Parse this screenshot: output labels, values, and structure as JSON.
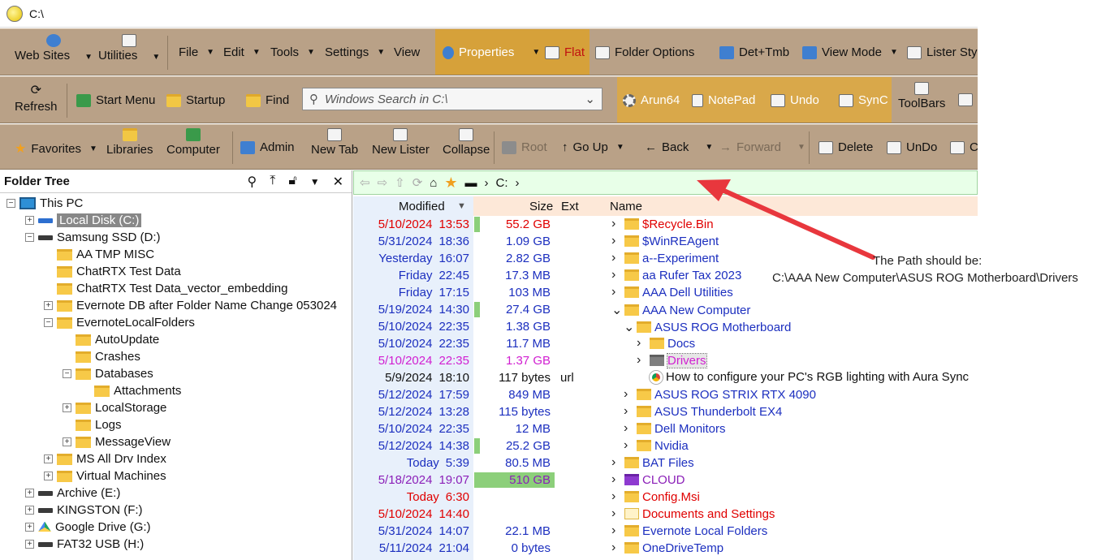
{
  "window": {
    "title": "C:\\"
  },
  "toolbar1": {
    "web_sites": "Web Sites",
    "utilities": "Utilities",
    "file": "File",
    "edit": "Edit",
    "tools": "Tools",
    "settings": "Settings",
    "view": "View",
    "properties": "Properties",
    "flat": "Flat",
    "folder_options": "Folder Options",
    "det_tmb": "Det+Tmb",
    "view_mode": "View Mode",
    "lister_style": "Lister Styl"
  },
  "toolbar2": {
    "refresh": "Refresh",
    "start_menu": "Start Menu",
    "startup": "Startup",
    "find": "Find",
    "search_placeholder": "Windows Search in C:\\",
    "arun64": "Arun64",
    "notepad": "NotePad",
    "undo": "Undo",
    "sync": "SynC",
    "toolbars": "ToolBars"
  },
  "toolbar3": {
    "favorites": "Favorites",
    "libraries": "Libraries",
    "computer": "Computer",
    "admin": "Admin",
    "new_tab": "New Tab",
    "new_lister": "New Lister",
    "collapse": "Collapse",
    "root": "Root",
    "go_up": "Go Up",
    "back": "Back",
    "forward": "Forward",
    "delete": "Delete",
    "undo": "UnDo",
    "co": "Co"
  },
  "folder_tree": {
    "title": "Folder Tree",
    "items": [
      {
        "label": "This PC",
        "icon": "pc-icon",
        "indent": 0,
        "exp": "−"
      },
      {
        "label": "Local Disk (C:)",
        "icon": "windows-drive-icon",
        "indent": 1,
        "exp": "+",
        "selected": true
      },
      {
        "label": "Samsung SSD (D:)",
        "icon": "drive-icon",
        "indent": 1,
        "exp": "−"
      },
      {
        "label": "AA TMP MISC",
        "icon": "folder-icon",
        "indent": 2,
        "exp": ""
      },
      {
        "label": "ChatRTX Test Data",
        "icon": "folder-icon",
        "indent": 2,
        "exp": ""
      },
      {
        "label": "ChatRTX Test Data_vector_embedding",
        "icon": "folder-icon",
        "indent": 2,
        "exp": ""
      },
      {
        "label": "Evernote DB after Folder Name Change 053024",
        "icon": "folder-icon",
        "indent": 2,
        "exp": "+"
      },
      {
        "label": "EvernoteLocalFolders",
        "icon": "folder-icon",
        "indent": 2,
        "exp": "−"
      },
      {
        "label": "AutoUpdate",
        "icon": "folder-icon",
        "indent": 3,
        "exp": ""
      },
      {
        "label": "Crashes",
        "icon": "folder-icon",
        "indent": 3,
        "exp": ""
      },
      {
        "label": "Databases",
        "icon": "folder-icon",
        "indent": 3,
        "exp": "−"
      },
      {
        "label": "Attachments",
        "icon": "folder-icon",
        "indent": 4,
        "exp": ""
      },
      {
        "label": "LocalStorage",
        "icon": "folder-icon",
        "indent": 3,
        "exp": "+"
      },
      {
        "label": "Logs",
        "icon": "folder-icon",
        "indent": 3,
        "exp": ""
      },
      {
        "label": "MessageView",
        "icon": "folder-icon",
        "indent": 3,
        "exp": "+"
      },
      {
        "label": "MS All Drv Index",
        "icon": "folder-icon",
        "indent": 2,
        "exp": "+"
      },
      {
        "label": "Virtual Machines",
        "icon": "folder-icon",
        "indent": 2,
        "exp": "+"
      },
      {
        "label": "Archive (E:)",
        "icon": "drive-icon",
        "indent": 1,
        "exp": "+"
      },
      {
        "label": "KINGSTON (F:)",
        "icon": "drive-icon",
        "indent": 1,
        "exp": "+"
      },
      {
        "label": "Google Drive (G:)",
        "icon": "google-drive-icon",
        "indent": 1,
        "exp": "+"
      },
      {
        "label": "FAT32 USB (H:)",
        "icon": "drive-icon",
        "indent": 1,
        "exp": "+"
      }
    ]
  },
  "lister": {
    "path": "C:",
    "columns": {
      "modified": "Modified",
      "size": "Size",
      "ext": "Ext",
      "name": "Name"
    },
    "rows": [
      {
        "date": "5/10/2024",
        "time": "13:53",
        "size": "55.2 GB",
        "ext": "",
        "name": "$Recycle.Bin",
        "color": "red",
        "depth": 0,
        "arrow": ">",
        "bar": "small",
        "icon": "folder"
      },
      {
        "date": "5/31/2024",
        "time": "18:36",
        "size": "1.09 GB",
        "ext": "",
        "name": "$WinREAgent",
        "color": "blue",
        "depth": 0,
        "arrow": ">",
        "bar": "",
        "icon": "folder"
      },
      {
        "date": "Yesterday",
        "time": "16:07",
        "size": "2.82 GB",
        "ext": "",
        "name": "a--Experiment",
        "color": "blue",
        "depth": 0,
        "arrow": ">",
        "bar": "",
        "icon": "folder"
      },
      {
        "date": "Friday",
        "time": "22:45",
        "size": "17.3 MB",
        "ext": "",
        "name": "aa Rufer Tax 2023",
        "color": "blue",
        "depth": 0,
        "arrow": ">",
        "bar": "",
        "icon": "folder"
      },
      {
        "date": "Friday",
        "time": "17:15",
        "size": "103 MB",
        "ext": "",
        "name": "AAA Dell Utilities",
        "color": "blue",
        "depth": 0,
        "arrow": ">",
        "bar": "",
        "icon": "folder"
      },
      {
        "date": "5/19/2024",
        "time": "14:30",
        "size": "27.4 GB",
        "ext": "",
        "name": "AAA New Computer",
        "color": "blue",
        "depth": 0,
        "arrow": "v",
        "bar": "small",
        "icon": "folder"
      },
      {
        "date": "5/10/2024",
        "time": "22:35",
        "size": "1.38 GB",
        "ext": "",
        "name": "ASUS ROG Motherboard",
        "color": "blue",
        "depth": 1,
        "arrow": "v",
        "bar": "",
        "icon": "folder"
      },
      {
        "date": "5/10/2024",
        "time": "22:35",
        "size": "11.7 MB",
        "ext": "",
        "name": "Docs",
        "color": "blue",
        "depth": 2,
        "arrow": ">",
        "bar": "",
        "icon": "folder"
      },
      {
        "date": "5/10/2024",
        "time": "22:35",
        "size": "1.37 GB",
        "ext": "",
        "name": "Drivers",
        "color": "magenta",
        "depth": 2,
        "arrow": ">",
        "bar": "",
        "icon": "gray-folder"
      },
      {
        "date": "5/9/2024",
        "time": "18:10",
        "size": "117 bytes",
        "ext": "url",
        "name": "How to configure your PC's RGB lighting with Aura Sync",
        "color": "black",
        "depth": 2,
        "arrow": "",
        "bar": "",
        "icon": "chrome"
      },
      {
        "date": "5/12/2024",
        "time": "17:59",
        "size": "849 MB",
        "ext": "",
        "name": "ASUS ROG STRIX RTX 4090",
        "color": "blue",
        "depth": 1,
        "arrow": ">",
        "bar": "",
        "icon": "folder"
      },
      {
        "date": "5/12/2024",
        "time": "13:28",
        "size": "115 bytes",
        "ext": "",
        "name": "ASUS Thunderbolt EX4",
        "color": "blue",
        "depth": 1,
        "arrow": ">",
        "bar": "",
        "icon": "folder"
      },
      {
        "date": "5/10/2024",
        "time": "22:35",
        "size": "12 MB",
        "ext": "",
        "name": "Dell Monitors",
        "color": "blue",
        "depth": 1,
        "arrow": ">",
        "bar": "",
        "icon": "folder"
      },
      {
        "date": "5/12/2024",
        "time": "14:38",
        "size": "25.2 GB",
        "ext": "",
        "name": "Nvidia",
        "color": "blue",
        "depth": 1,
        "arrow": ">",
        "bar": "small",
        "icon": "folder"
      },
      {
        "date": "Today",
        "time": "5:39",
        "size": "80.5 MB",
        "ext": "",
        "name": "BAT Files",
        "color": "blue",
        "depth": 0,
        "arrow": ">",
        "bar": "",
        "icon": "folder"
      },
      {
        "date": "5/18/2024",
        "time": "19:07",
        "size": "510 GB",
        "ext": "",
        "name": "CLOUD",
        "color": "purple",
        "depth": 0,
        "arrow": ">",
        "bar": "full",
        "icon": "purple-folder"
      },
      {
        "date": "Today",
        "time": "6:30",
        "size": "",
        "ext": "",
        "name": "Config.Msi",
        "color": "red",
        "depth": 0,
        "arrow": ">",
        "bar": "",
        "icon": "folder"
      },
      {
        "date": "5/10/2024",
        "time": "14:40",
        "size": "",
        "ext": "",
        "name": "Documents and Settings",
        "color": "red",
        "depth": 0,
        "arrow": ">",
        "bar": "",
        "icon": "shortcut-folder"
      },
      {
        "date": "5/31/2024",
        "time": "14:07",
        "size": "22.1 MB",
        "ext": "",
        "name": "Evernote Local Folders",
        "color": "blue",
        "depth": 0,
        "arrow": ">",
        "bar": "",
        "icon": "folder"
      },
      {
        "date": "5/11/2024",
        "time": "21:04",
        "size": "0 bytes",
        "ext": "",
        "name": "OneDriveTemp",
        "color": "blue",
        "depth": 0,
        "arrow": ">",
        "bar": "",
        "icon": "folder"
      }
    ]
  },
  "annotation": {
    "line1": "The Path should be:",
    "line2": "C:\\AAA New Computer\\ASUS ROG Motherboard\\Drivers",
    "arrow_color": "#e8373d"
  },
  "colors": {
    "toolbar_bg": "#b9a187",
    "highlight": "#d6a13a",
    "red": "#e00000",
    "blue": "#1c2fbf",
    "purple": "#8b1fb8",
    "magenta": "#d11fd1"
  }
}
